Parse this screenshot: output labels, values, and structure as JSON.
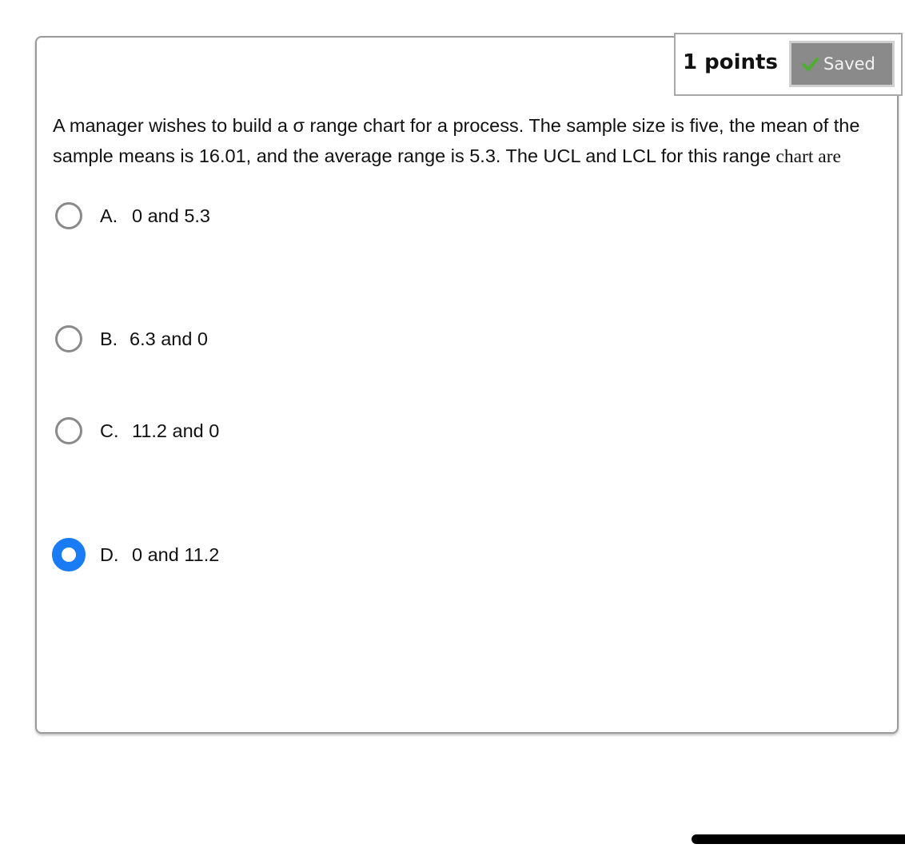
{
  "header": {
    "points_label": "1 points",
    "saved_label": "Saved"
  },
  "question": {
    "text_main": "A manager wishes to build a σ range chart for a process. The sample size is five, the mean of the sample means is 16.01, and the average range is 5.3.  The UCL and LCL for this range",
    "text_tail": "chart are"
  },
  "options": [
    {
      "letter": "A.",
      "text": "0 and 5.3",
      "selected": false
    },
    {
      "letter": "B.",
      "text": "6.3 and 0",
      "selected": false
    },
    {
      "letter": "C.",
      "text": "11.2 and 0",
      "selected": false
    },
    {
      "letter": "D.",
      "text": "0 and 11.2",
      "selected": true
    }
  ],
  "colors": {
    "selected_radio": "#1a7cf5",
    "saved_badge": "#8a8a8a",
    "check": "#4caf30"
  }
}
